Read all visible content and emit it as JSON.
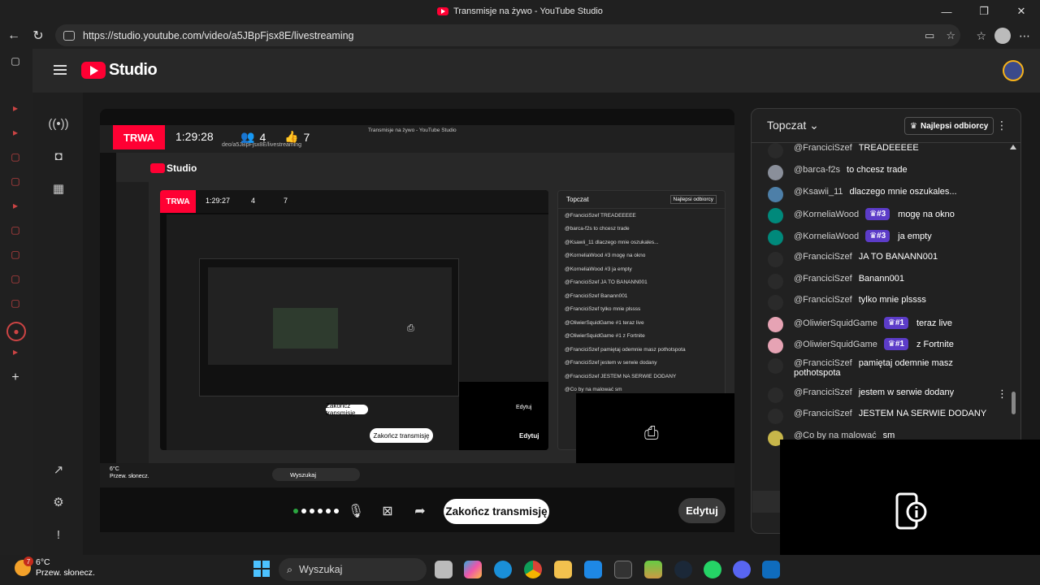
{
  "window": {
    "title": "Transmisje na żywo - YouTube Studio",
    "controls": [
      "—",
      "❐",
      "✕"
    ]
  },
  "browser": {
    "url": "https://studio.youtube.com/video/a5JBpFjsx8E/livestreaming"
  },
  "studio": {
    "logo_text": "Studio"
  },
  "stream": {
    "status": "TRWA",
    "duration": "1:29:28",
    "viewers": "4",
    "likes": "7"
  },
  "nested": {
    "title": "Transmisje na żywo - YouTube Studio",
    "url": "deo/a5JBpFjsx8E/livestreaming",
    "logo_text": "Studio",
    "status": "TRWA",
    "duration": "1:29:27",
    "viewers": "4",
    "likes": "7",
    "chat_title": "Topczat",
    "top_fans": "Najlepsi odbiorcy",
    "end_label": "Zakończ transmisję",
    "edit_label": "Edytuj",
    "search": "Wyszukaj",
    "temp": "6°C",
    "weather": "Przew. słonecz.",
    "chat": [
      "@FranciciSzef  TREADEEEEE",
      "@barca-f2s  to chcesz trade",
      "@Ksawii_11  dlaczego mnie oszukales...",
      "@KorneliaWood  #3  mogę na okno",
      "@KorneliaWood  #3  ja empty",
      "@FranciciSzef  JA TO BANANN001",
      "@FranciciSzef  Banann001",
      "@FranciciSzef  tylko mnie plssss",
      "@OliwierSquidGame  #1  teraz live",
      "@OliwierSquidGame  #1  z Fortnite",
      "@FranciciSzef  pamiętaj odemnie masz pothotspota",
      "@FranciciSzef  jestem w serwie dodany",
      "@FranciciSzef  JESTEM NA SERWIE DODANY",
      "@Co by na malować  sm"
    ]
  },
  "controls": {
    "end_label": "Zakończ transmisję",
    "edit_label": "Edytuj"
  },
  "chat": {
    "title": "Topczat",
    "top_fans": "Najlepsi odbiorcy",
    "messages": [
      {
        "author": "@FranciciSzef",
        "badge": "",
        "text": "TREADEEEEE",
        "color": "#2a2a2a"
      },
      {
        "author": "@barca-f2s",
        "badge": "",
        "text": "to chcesz trade",
        "color": "#8a8f9a"
      },
      {
        "author": "@Ksawii_11",
        "badge": "",
        "text": "dlaczego mnie oszukales...",
        "color": "#4d7fa8"
      },
      {
        "author": "@KorneliaWood",
        "badge": "#3",
        "text": "mogę na okno",
        "color": "#00897b"
      },
      {
        "author": "@KorneliaWood",
        "badge": "#3",
        "text": "ja empty",
        "color": "#00897b"
      },
      {
        "author": "@FranciciSzef",
        "badge": "",
        "text": "JA TO BANANN001",
        "color": "#2a2a2a"
      },
      {
        "author": "@FranciciSzef",
        "badge": "",
        "text": "Banann001",
        "color": "#2a2a2a"
      },
      {
        "author": "@FranciciSzef",
        "badge": "",
        "text": "tylko mnie plssss",
        "color": "#2a2a2a"
      },
      {
        "author": "@OliwierSquidGame",
        "badge": "#1",
        "text": "teraz live",
        "color": "#e6a3b4"
      },
      {
        "author": "@OliwierSquidGame",
        "badge": "#1",
        "text": "z Fortnite",
        "color": "#e6a3b4"
      },
      {
        "author": "@FranciciSzef",
        "badge": "",
        "text": "pamiętaj odemnie masz",
        "text2": "pothotspota",
        "color": "#2a2a2a"
      },
      {
        "author": "@FranciciSzef",
        "badge": "",
        "text": "jestem w serwie dodany",
        "color": "#2a2a2a"
      },
      {
        "author": "@FranciciSzef",
        "badge": "",
        "text": "JESTEM NA SERWIE DODANY",
        "color": "#2a2a2a"
      },
      {
        "author": "@Co by na malować",
        "badge": "",
        "text": "sm",
        "color": "#c7b64a"
      }
    ]
  },
  "taskbar": {
    "temp": "6°C",
    "weather": "Przew. słonecz.",
    "search_placeholder": "Wyszukaj",
    "notif_count": "7"
  },
  "colors": {
    "live_red": "#ff0033",
    "badge_purple": "#5c3cc8",
    "accent_blue": "#4cc2ff"
  }
}
